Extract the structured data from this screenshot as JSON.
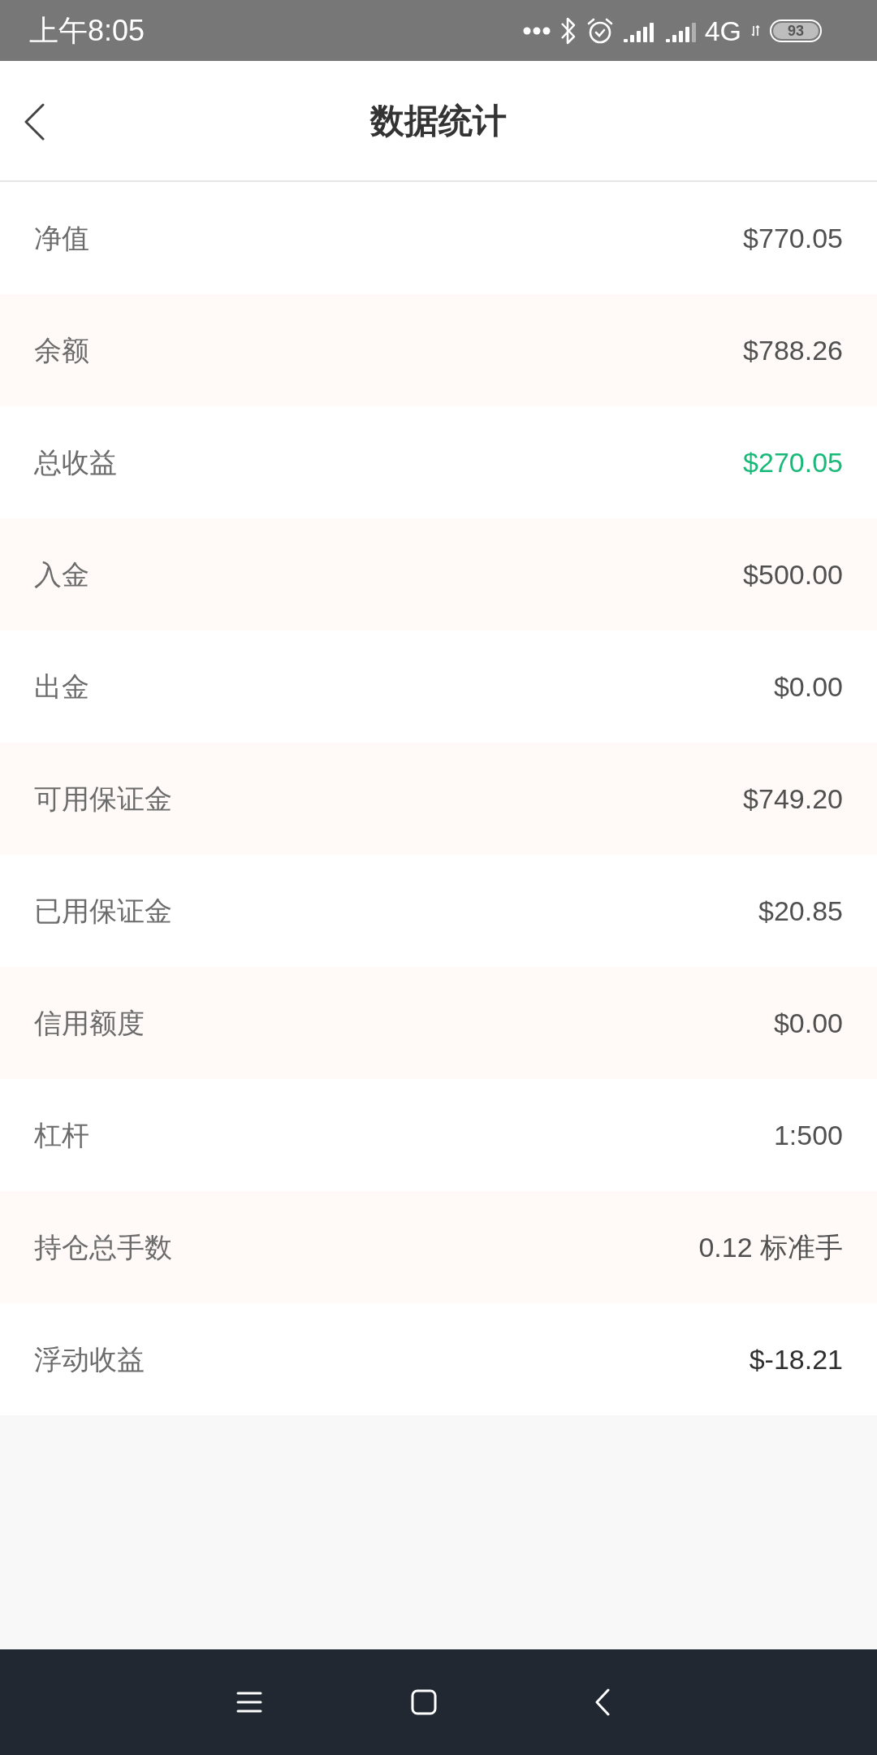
{
  "status_bar": {
    "time": "上午8:05",
    "network": "4G",
    "battery": "93"
  },
  "header": {
    "title": "数据统计"
  },
  "rows": [
    {
      "label": "净值",
      "value": "$770.05",
      "color": "#505050"
    },
    {
      "label": "余额",
      "value": "$788.26",
      "color": "#505050"
    },
    {
      "label": "总收益",
      "value": "$270.05",
      "color": "#19b979"
    },
    {
      "label": "入金",
      "value": "$500.00",
      "color": "#505050"
    },
    {
      "label": "出金",
      "value": "$0.00",
      "color": "#505050"
    },
    {
      "label": "可用保证金",
      "value": "$749.20",
      "color": "#505050"
    },
    {
      "label": "已用保证金",
      "value": "$20.85",
      "color": "#505050"
    },
    {
      "label": "信用额度",
      "value": "$0.00",
      "color": "#505050"
    },
    {
      "label": "杠杆",
      "value": "1:500",
      "color": "#505050"
    },
    {
      "label": "持仓总手数",
      "value": "0.12 标准手",
      "color": "#505050"
    },
    {
      "label": "浮动收益",
      "value": "$-18.21",
      "color": "#2e2e2e"
    }
  ]
}
